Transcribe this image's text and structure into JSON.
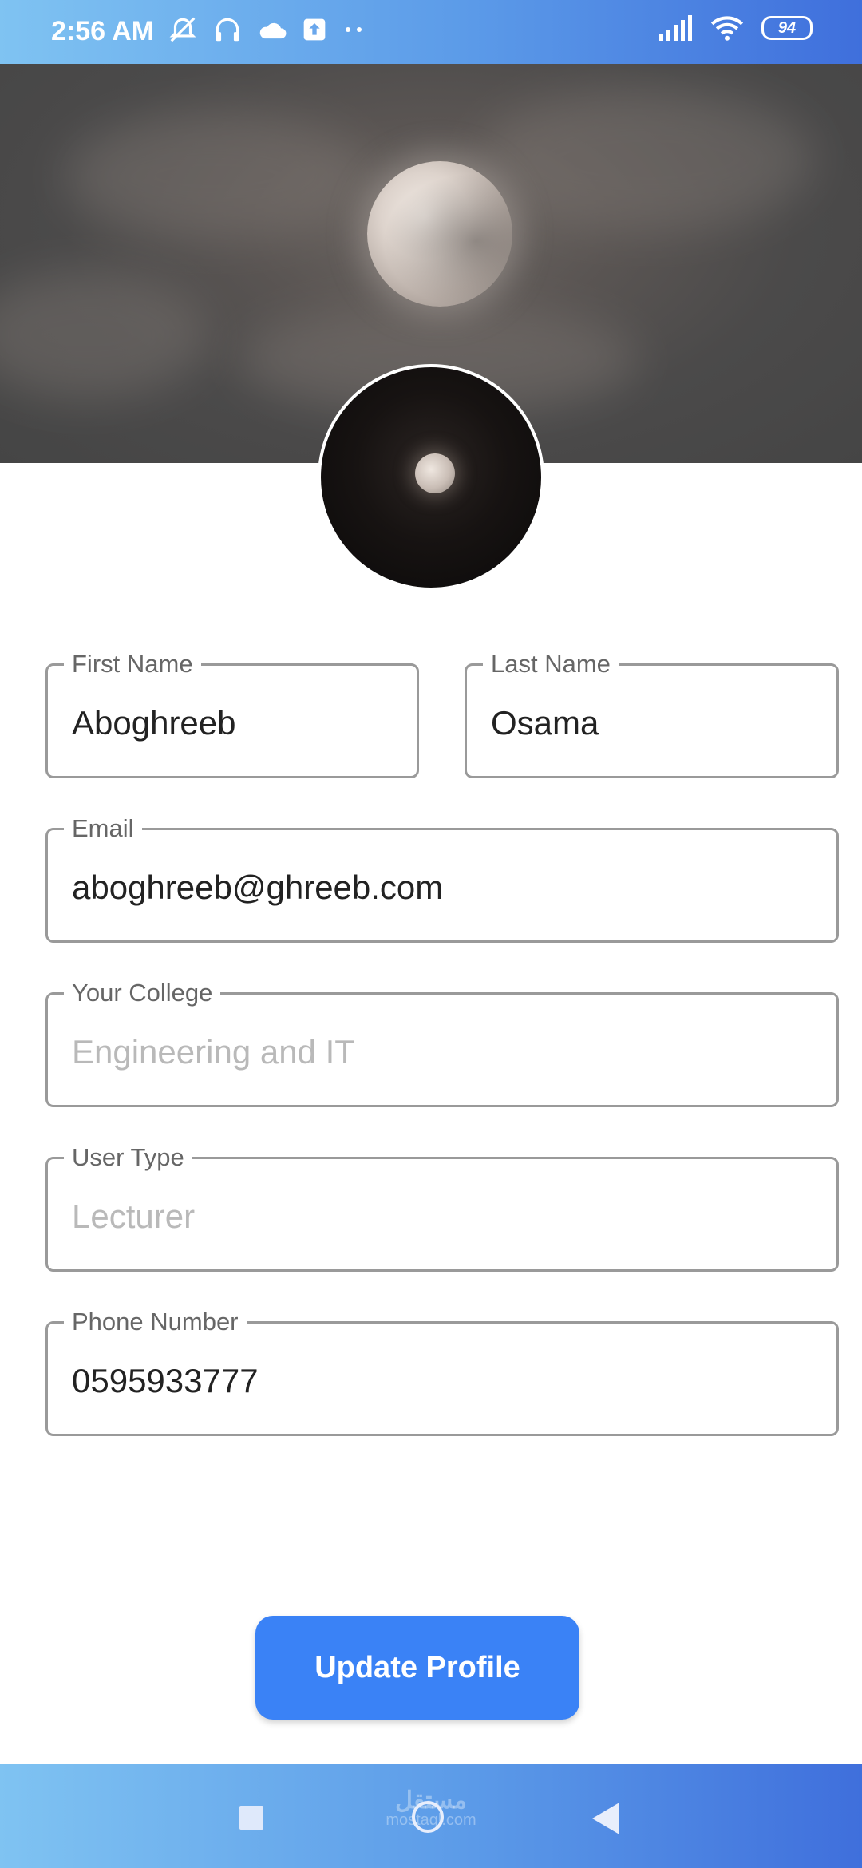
{
  "status_bar": {
    "time": "2:56 AM",
    "battery_level": "94",
    "left_icons": [
      "mute-alarm-icon",
      "headphones-icon",
      "cloud-icon",
      "upload-icon",
      "more-dots-icon"
    ],
    "right_icons": [
      "signal-icon",
      "wifi-icon",
      "battery-icon"
    ]
  },
  "profile": {
    "cover_image": "moon-night-sky",
    "avatar_image": "moon-night-sky-dark"
  },
  "form": {
    "first_name": {
      "label": "First Name",
      "value": "Aboghreeb"
    },
    "last_name": {
      "label": "Last Name",
      "value": "Osama"
    },
    "email": {
      "label": "Email",
      "value": "aboghreeb@ghreeb.com"
    },
    "college": {
      "label": "Your College",
      "placeholder": "Engineering and IT"
    },
    "user_type": {
      "label": "User Type",
      "placeholder": "Lecturer"
    },
    "phone": {
      "label": "Phone Number",
      "value": "0595933777"
    }
  },
  "actions": {
    "update_label": "Update Profile"
  },
  "colors": {
    "accent": "#3a82f6",
    "bar_gradient_start": "#7fc3f2",
    "bar_gradient_end": "#3f6fdc",
    "field_border": "#9a9a9a"
  },
  "nav_bar": {
    "buttons": [
      "recents-square-icon",
      "home-circle-icon",
      "back-triangle-icon"
    ]
  },
  "watermark": {
    "text": "مستقل",
    "subtext": "mostaql.com"
  }
}
